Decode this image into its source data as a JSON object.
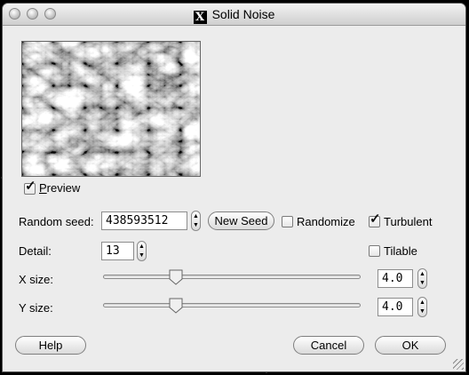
{
  "window": {
    "title": "Solid Noise",
    "title_icon": "x11-icon"
  },
  "preview": {
    "checkbox_label": "Preview",
    "checked": true
  },
  "random_seed": {
    "label": "Random seed:",
    "value": "438593512",
    "new_seed_label": "New Seed"
  },
  "options": {
    "randomize_label": "Randomize",
    "randomize_checked": false,
    "turbulent_label": "Turbulent",
    "turbulent_checked": true,
    "tilable_label": "Tilable",
    "tilable_checked": false
  },
  "detail": {
    "label": "Detail:",
    "value": "13"
  },
  "x_size": {
    "label": "X size:",
    "value": "4.0",
    "slider_fraction": 0.27
  },
  "y_size": {
    "label": "Y size:",
    "value": "4.0",
    "slider_fraction": 0.27
  },
  "buttons": {
    "help": "Help",
    "cancel": "Cancel",
    "ok": "OK"
  },
  "colors": {
    "dialog_bg": "#ececec",
    "desktop_bg": "#000000"
  }
}
